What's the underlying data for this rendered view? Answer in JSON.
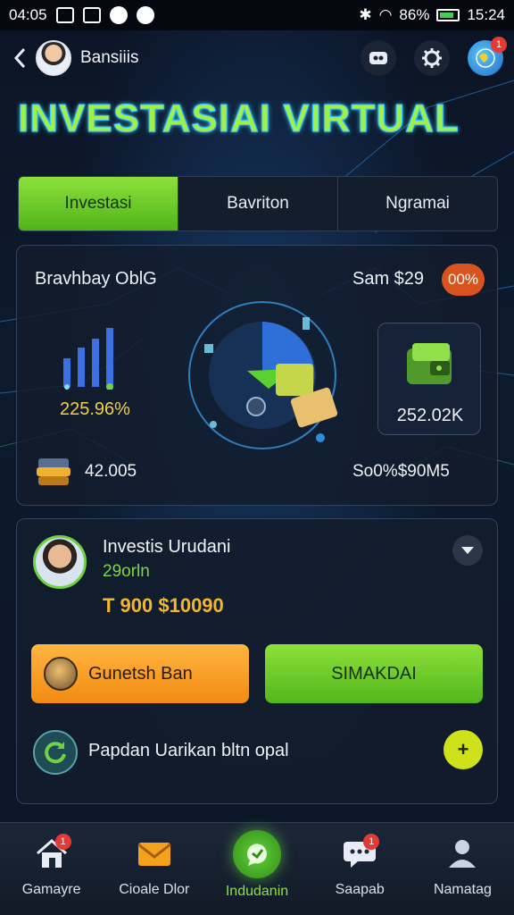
{
  "status_bar": {
    "time": "04:05",
    "battery_pct": "86%",
    "clock_right": "15:24"
  },
  "header": {
    "user_name": "Bansiiis"
  },
  "title": "INVESTASIAI VIRTUAL",
  "tabs": [
    {
      "label": "Investasi",
      "active": true
    },
    {
      "label": "Bavriton",
      "active": false
    },
    {
      "label": "Ngramai",
      "active": false
    }
  ],
  "overview": {
    "title": "Bravhbay OblG",
    "amount": "Sam $29",
    "badge": "00%",
    "percent": "225.96%",
    "side_value": "252.02K",
    "bottom_left_value": "42.005",
    "bottom_right_value": "So0%$90M5"
  },
  "profile": {
    "name": "Investis Urudani",
    "subtitle": "29orln",
    "values": "T 900 $10090",
    "btn_primary": "Gunetsh Ban",
    "btn_secondary": "SIMAKDAI",
    "info_text": "Papdan Uarikan bltn opal",
    "info_btn": "+"
  },
  "bottom_nav": [
    {
      "label": "Gamayre",
      "icon": "home-icon",
      "badge": "1",
      "active": false
    },
    {
      "label": "Cioale Dlor",
      "icon": "mail-icon",
      "badge": "",
      "active": false
    },
    {
      "label": "Indudanin",
      "icon": "chat-bubble-icon",
      "badge": "",
      "active": true
    },
    {
      "label": "Saapab",
      "icon": "message-icon",
      "badge": "1",
      "active": false
    },
    {
      "label": "Namatag",
      "icon": "profile-icon",
      "badge": "",
      "active": false
    }
  ],
  "colors": {
    "accent_green": "#6fd244",
    "accent_orange": "#f28a12",
    "badge_red": "#e53935",
    "title_glow": "#37c8ff"
  }
}
